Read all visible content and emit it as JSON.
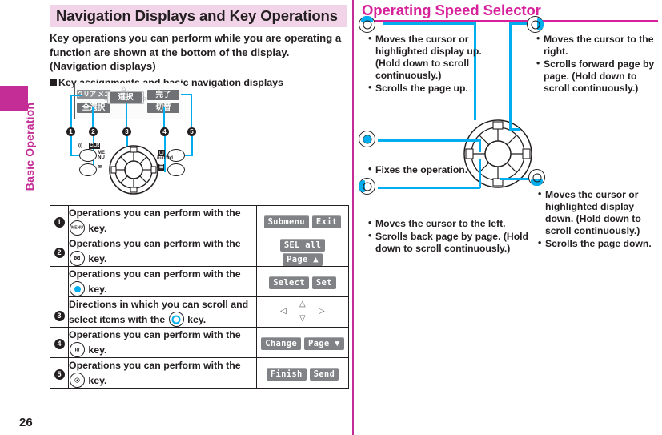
{
  "sidebar": {
    "chapter_label": "Basic Operation",
    "tab_color": "#c32d95",
    "page_number": "26"
  },
  "left": {
    "title": "Navigation Displays and Key Operations",
    "intro": "Key operations you can perform while you are operating a function are shown at the bottom of the display. (Navigation displays)",
    "subhead": "Key assignments and basic navigation displays",
    "phone": {
      "softkeys": {
        "top_left": "クリア メニュー",
        "bottom_left": "全選択",
        "center": "選択",
        "top_right": "完了",
        "bottom_right": "切替"
      },
      "markers": [
        "1",
        "2",
        "3",
        "4",
        "5"
      ],
      "key_glyphs": {
        "menu": "MENU",
        "mail": "MAIL",
        "camera": "CAMERA",
        "itv": "iα"
      }
    },
    "table": {
      "rows": [
        {
          "num": "1",
          "text_before": "Operations you can perform with the",
          "key_glyph": "MENU",
          "key_type": "plain",
          "text_after": "key.",
          "buttons": [
            "Submenu",
            "Exit"
          ]
        },
        {
          "num": "2",
          "text_before": "Operations you can perform with the",
          "key_glyph": "✉",
          "key_type": "plain",
          "text_after": "key.",
          "buttons": [
            "SEL all",
            "Page ▲"
          ]
        },
        {
          "num": "3",
          "text_before": "Operations you can perform with the",
          "key_glyph": "",
          "key_type": "cyan-dot",
          "text_after": "key.",
          "buttons": [
            "Select",
            "Set"
          ]
        },
        {
          "num": "",
          "text_before": "Directions in which you can scroll and select items with the",
          "key_glyph": "",
          "key_type": "cyan-ring",
          "text_after": "key.",
          "buttons": [],
          "arrows": {
            "up": "△",
            "down": "▽",
            "left": "◁",
            "right": "▷"
          }
        },
        {
          "num": "4",
          "text_before": "Operations you can perform with the",
          "key_glyph": "iα",
          "key_type": "plain",
          "text_after": "key.",
          "buttons": [
            "Change",
            "Page ▼"
          ]
        },
        {
          "num": "5",
          "text_before": "Operations you can perform with the",
          "key_glyph": "☉",
          "key_type": "plain",
          "text_after": "key.",
          "buttons": [
            "Finish",
            "Send"
          ]
        }
      ]
    }
  },
  "right": {
    "title": "Operating Speed Selector",
    "accent_color": "#d6219a",
    "highlight_color": "#00aeef",
    "callouts": [
      {
        "id": "up",
        "direction": "up",
        "items": [
          "Moves the cursor or highlighted display up. (Hold down to scroll continuously.)",
          "Scrolls the page up."
        ]
      },
      {
        "id": "right",
        "direction": "right",
        "items": [
          "Moves the cursor to the right.",
          "Scrolls forward page by page. (Hold down to scroll continuously.)"
        ]
      },
      {
        "id": "center",
        "direction": "center",
        "items": [
          "Fixes the operation."
        ]
      },
      {
        "id": "left",
        "direction": "left",
        "items": [
          "Moves the cursor to the left.",
          "Scrolls back page by page. (Hold down to scroll continuously.)"
        ]
      },
      {
        "id": "down",
        "direction": "down",
        "items": [
          "Moves the cursor or highlighted display down. (Hold down to scroll continuously.)",
          "Scrolls the page down."
        ]
      }
    ]
  }
}
